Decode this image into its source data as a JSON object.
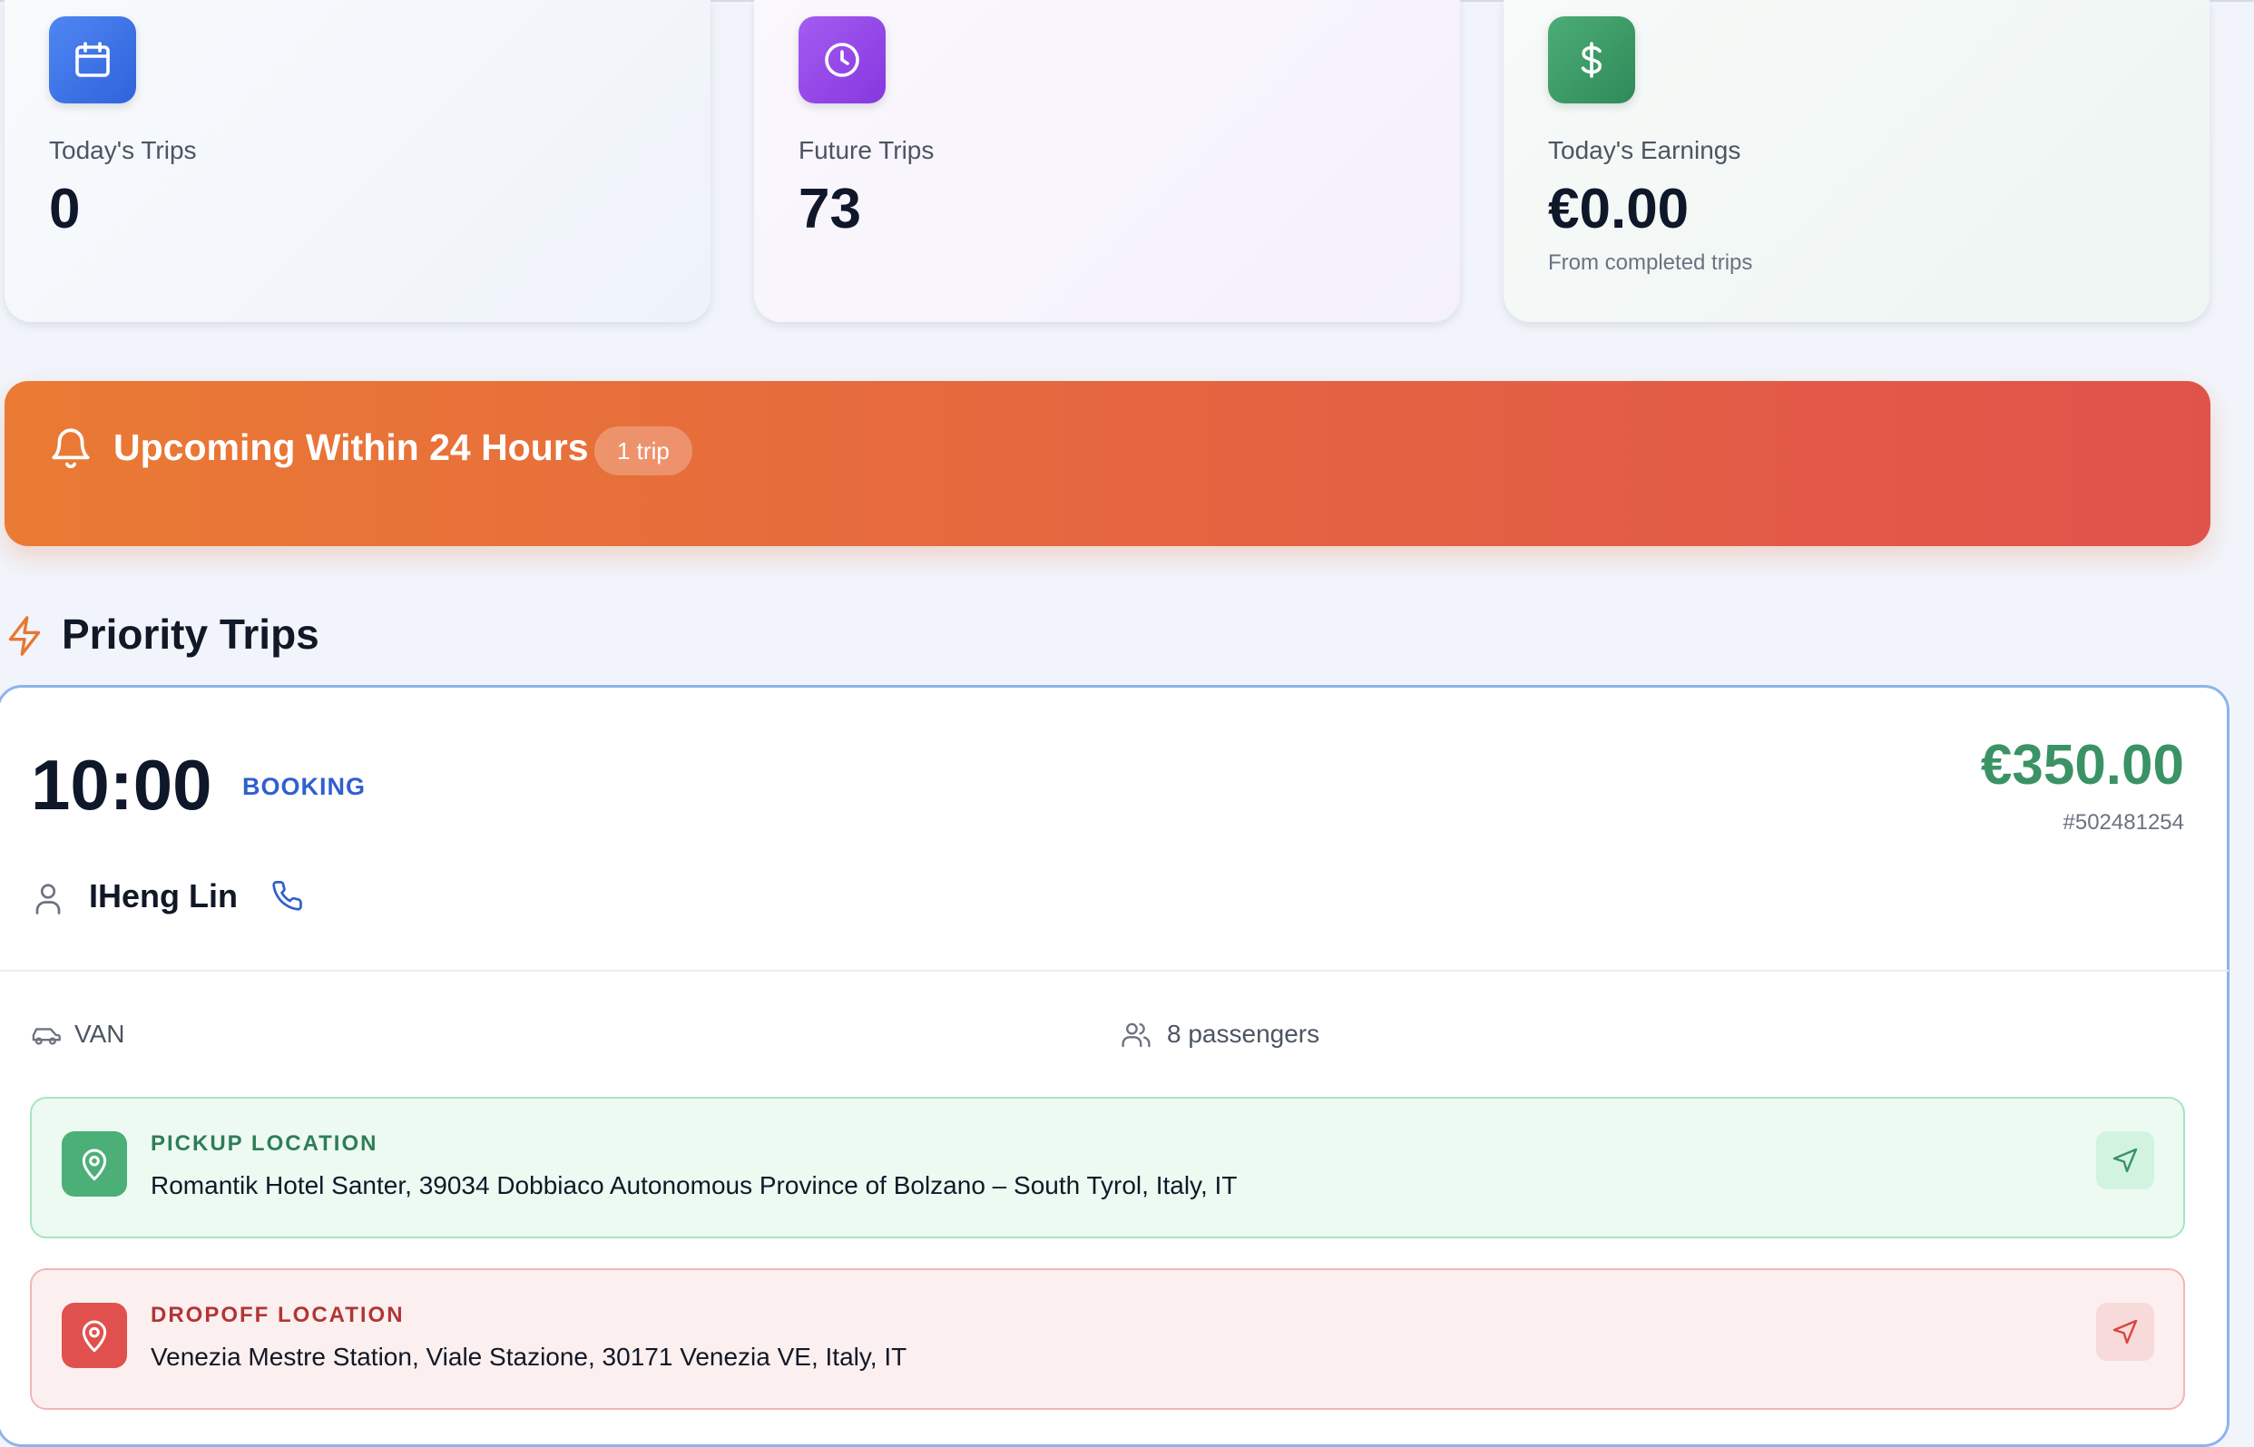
{
  "stats": [
    {
      "label": "Today's Trips",
      "value": "0",
      "sub": "",
      "icon": "calendar-icon",
      "color": "#3b74e8"
    },
    {
      "label": "Future Trips",
      "value": "73",
      "sub": "",
      "icon": "clock-icon",
      "color": "#9446e8"
    },
    {
      "label": "Today's Earnings",
      "value": "€0.00",
      "sub": "From completed trips",
      "icon": "dollar-icon",
      "color": "#3e9c69"
    }
  ],
  "banner": {
    "title": "Upcoming Within 24 Hours",
    "badge": "1 trip",
    "icon": "bell-icon"
  },
  "priority": {
    "title": "Priority Trips",
    "icon": "lightning-icon",
    "trip": {
      "time": "10:00",
      "type": "BOOKING",
      "price": "€350.00",
      "id": "#502481254",
      "passenger_name": "IHeng Lin",
      "vehicle": "VAN",
      "passengers": "8 passengers",
      "pickup": {
        "label": "PICKUP LOCATION",
        "address": "Romantik Hotel Santer, 39034 Dobbiaco Autonomous Province of Bolzano – South Tyrol, Italy, IT"
      },
      "dropoff": {
        "label": "DROPOFF LOCATION",
        "address": "Venezia Mestre Station, Viale Stazione, 30171 Venezia VE, Italy, IT"
      }
    }
  },
  "colors": {
    "accent_blue": "#2f5fcf",
    "price_green": "#3a9265",
    "banner_start": "#ea7a34",
    "banner_end": "#e0534b"
  }
}
